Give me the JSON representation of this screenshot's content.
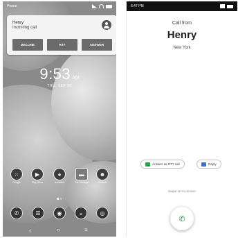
{
  "lock_screen": {
    "status_left": "Phone",
    "notification": {
      "caller_name": "Henry",
      "caller_sub": "Incoming call",
      "decline_label": "DECLINE",
      "rtt_label": "RTT",
      "answer_label": "ANSWER"
    },
    "clock": {
      "time": "9:53",
      "ampm": "AM",
      "date": "THU, SEP 30"
    },
    "apps": [
      {
        "label": "Google",
        "icon": "google-apps-icon"
      },
      {
        "label": "Play Store",
        "icon": "play-store-icon"
      },
      {
        "label": "Assistant",
        "icon": "assistant-icon"
      },
      {
        "label": "File Manager",
        "icon": "folder-icon"
      },
      {
        "label": "Contacts",
        "icon": "contacts-icon"
      }
    ],
    "dock": [
      {
        "icon": "phone-icon"
      },
      {
        "icon": "messages-icon"
      },
      {
        "icon": "chrome-icon"
      },
      {
        "icon": "gallery-icon"
      },
      {
        "icon": "camera-icon"
      }
    ]
  },
  "call_screen": {
    "status_time": "6:47 PM",
    "call_from": "Call from",
    "caller_name": "Henry",
    "caller_location": "New York",
    "rtt_chip": "Answer as RTT call",
    "reply_chip": "Reply",
    "swipe_hint": "Swipe up to answer",
    "accent_green": "#2e9e4f",
    "accent_blue": "#3b6fd4"
  }
}
